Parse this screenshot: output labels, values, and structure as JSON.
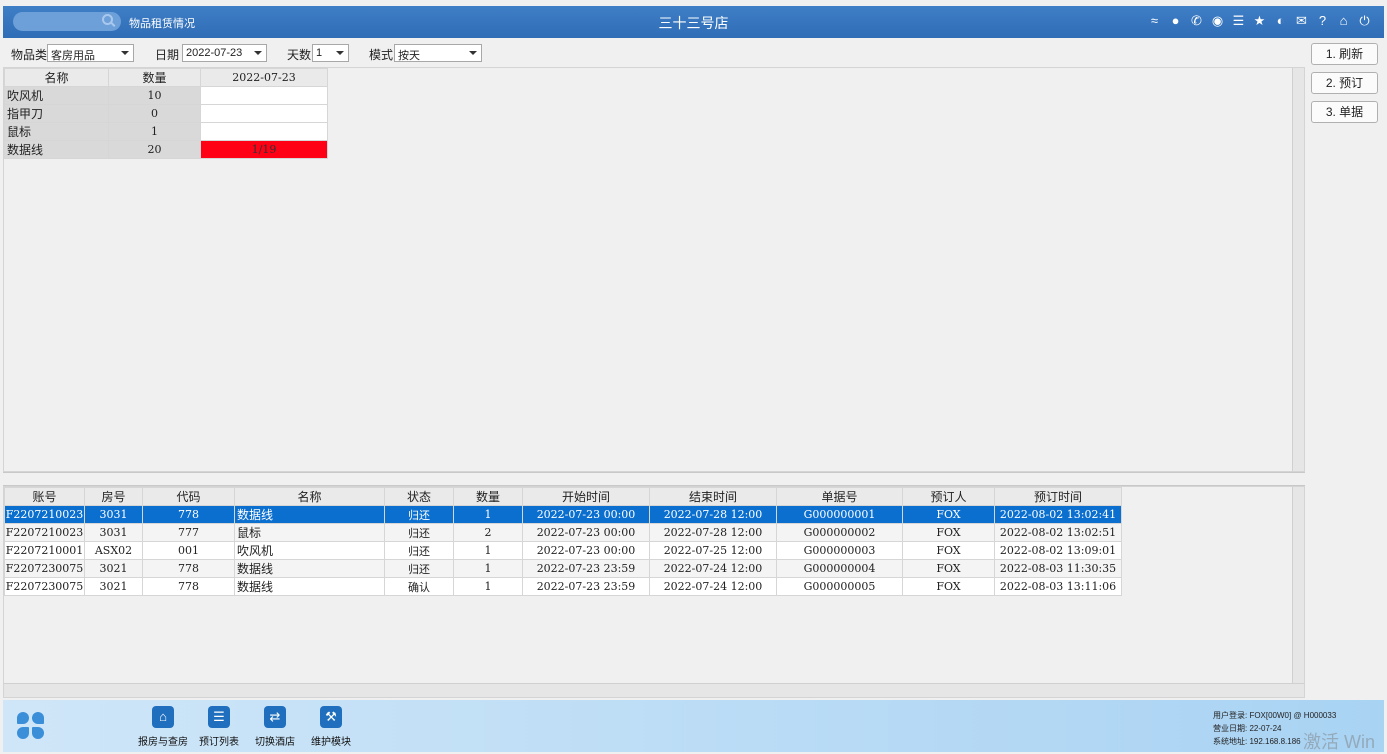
{
  "titlebar": {
    "app_title": "物品租赁情况",
    "store_title": "三十三号店",
    "icons": [
      "wifi-icon",
      "chat-icon",
      "phone-icon",
      "palette-icon",
      "menu-icon",
      "star-icon",
      "contrast-icon",
      "mail-icon",
      "help-icon",
      "home-icon",
      "power-icon"
    ]
  },
  "filters": {
    "category_label": "物品类",
    "category_value": "客房用品",
    "date_label": "日期",
    "date_value": "2022-07-23",
    "days_label": "天数",
    "days_value": "1",
    "mode_label": "模式",
    "mode_value": "按天"
  },
  "side_buttons": [
    "1. 刷新",
    "2. 预订",
    "3. 单据"
  ],
  "summary": {
    "headers": [
      "名称",
      "数量",
      "2022-07-23"
    ],
    "rows": [
      {
        "name": "吹风机",
        "qty": "10",
        "day": ""
      },
      {
        "name": "指甲刀",
        "qty": "0",
        "day": ""
      },
      {
        "name": "鼠标",
        "qty": "1",
        "day": ""
      },
      {
        "name": "数据线",
        "qty": "20",
        "day": "1/19"
      }
    ],
    "highlight_color": "#ff0014"
  },
  "details": {
    "headers": [
      "账号",
      "房号",
      "代码",
      "名称",
      "状态",
      "数量",
      "开始时间",
      "结束时间",
      "单据号",
      "预订人",
      "预订时间"
    ],
    "rows": [
      [
        "F2207210023",
        "3031",
        "778",
        "数据线",
        "归还",
        "1",
        "2022-07-23 00:00",
        "2022-07-28 12:00",
        "G000000001",
        "FOX",
        "2022-08-02 13:02:41"
      ],
      [
        "F2207210023",
        "3031",
        "777",
        "鼠标",
        "归还",
        "2",
        "2022-07-23 00:00",
        "2022-07-28 12:00",
        "G000000002",
        "FOX",
        "2022-08-02 13:02:51"
      ],
      [
        "F2207210001",
        "ASX02",
        "001",
        "吹风机",
        "归还",
        "1",
        "2022-07-23 00:00",
        "2022-07-25 12:00",
        "G000000003",
        "FOX",
        "2022-08-02 13:09:01"
      ],
      [
        "F2207230075",
        "3021",
        "778",
        "数据线",
        "归还",
        "1",
        "2022-07-23 23:59",
        "2022-07-24 12:00",
        "G000000004",
        "FOX",
        "2022-08-03 11:30:35"
      ],
      [
        "F2207230075",
        "3021",
        "778",
        "数据线",
        "确认",
        "1",
        "2022-07-23 23:59",
        "2022-07-24 12:00",
        "G000000005",
        "FOX",
        "2022-08-03 13:11:06"
      ]
    ],
    "selected_color": "#0b6fcf"
  },
  "taskbar": {
    "buttons": [
      {
        "label": "报房与查房",
        "icon": "house-icon"
      },
      {
        "label": "预订列表",
        "icon": "booking-list-icon"
      },
      {
        "label": "切换酒店",
        "icon": "switch-icon"
      },
      {
        "label": "维护模块",
        "icon": "wrench-icon"
      }
    ],
    "info": {
      "user": "用户登录:  FOX[00W0] @ H000033",
      "biz_date": "营业日期:   22-07-24",
      "sys_addr": "系统地址:   192.168.8.186"
    },
    "watermark": "激活 Win"
  }
}
